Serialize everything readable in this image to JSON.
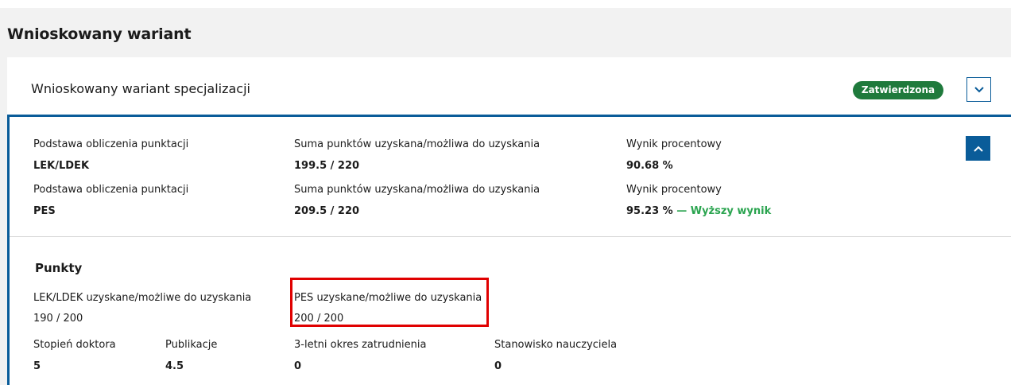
{
  "page_title": "Wnioskowany wariant",
  "card": {
    "title": "Wnioskowany wariant specjalizacji",
    "status": "Zatwierdzona",
    "colors": {
      "status_bg": "#1f7a3c",
      "accent": "#0a5c99",
      "highlight_text": "#2aa44f",
      "annotation": "#e00000"
    }
  },
  "rows": [
    {
      "basis_label": "Podstawa obliczenia punktacji",
      "basis_value": "LEK/LDEK",
      "sum_label": "Suma punktów uzyskana/możliwa do uzyskania",
      "sum_value": "199.5 / 220",
      "pct_label": "Wynik procentowy",
      "pct_value": "90.68 %",
      "pct_note": ""
    },
    {
      "basis_label": "Podstawa obliczenia punktacji",
      "basis_value": "PES",
      "sum_label": "Suma punktów uzyskana/możliwa do uzyskania",
      "sum_value": "209.5 / 220",
      "pct_label": "Wynik procentowy",
      "pct_value": "95.23 %",
      "pct_note": "— Wyższy wynik"
    }
  ],
  "points": {
    "title": "Punkty",
    "lek_label": "LEK/LDEK uzyskane/możliwe do uzyskania",
    "lek_value": "190 / 200",
    "pes_label": "PES uzyskane/możliwe do uzyskania",
    "pes_value": "200 / 200",
    "items": [
      {
        "label": "Stopień doktora",
        "value": "5"
      },
      {
        "label": "Publikacje",
        "value": "4.5"
      },
      {
        "label": "3-letni okres zatrudnienia",
        "value": "0"
      },
      {
        "label": "Stanowisko nauczyciela",
        "value": "0"
      }
    ]
  },
  "icons": {
    "collapse": "chevron-down-icon",
    "expand": "chevron-up-icon"
  }
}
